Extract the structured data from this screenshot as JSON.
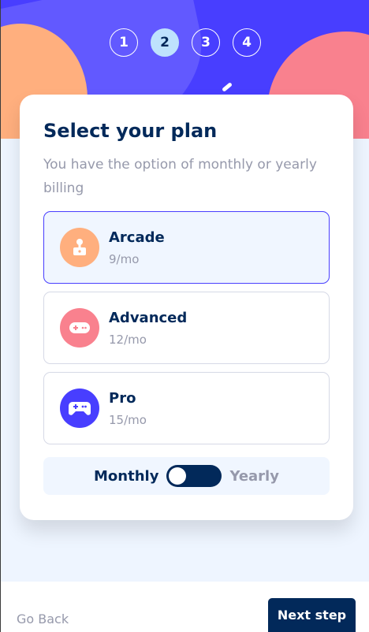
{
  "steps": [
    "1",
    "2",
    "3",
    "4"
  ],
  "active_step": "2",
  "title": "Select your plan",
  "subtitle": "You have the option of monthly or yearly billing",
  "plans": [
    {
      "name": "Arcade",
      "price": "9/mo",
      "icon": "arcade-icon",
      "color": "#ffaf7e",
      "selected": true
    },
    {
      "name": "Advanced",
      "price": "12/mo",
      "icon": "gamepad-icon",
      "color": "#f9818e",
      "selected": false
    },
    {
      "name": "Pro",
      "price": "15/mo",
      "icon": "controller-icon",
      "color": "#483eff",
      "selected": false
    }
  ],
  "billing": {
    "monthly_label": "Monthly",
    "yearly_label": "Yearly",
    "selected": "Monthly"
  },
  "footer": {
    "back_label": "Go Back",
    "next_label": "Next step"
  },
  "colors": {
    "accent": "#483eff",
    "navy": "#02295a",
    "gray": "#9699ab",
    "background": "#eef5ff"
  }
}
